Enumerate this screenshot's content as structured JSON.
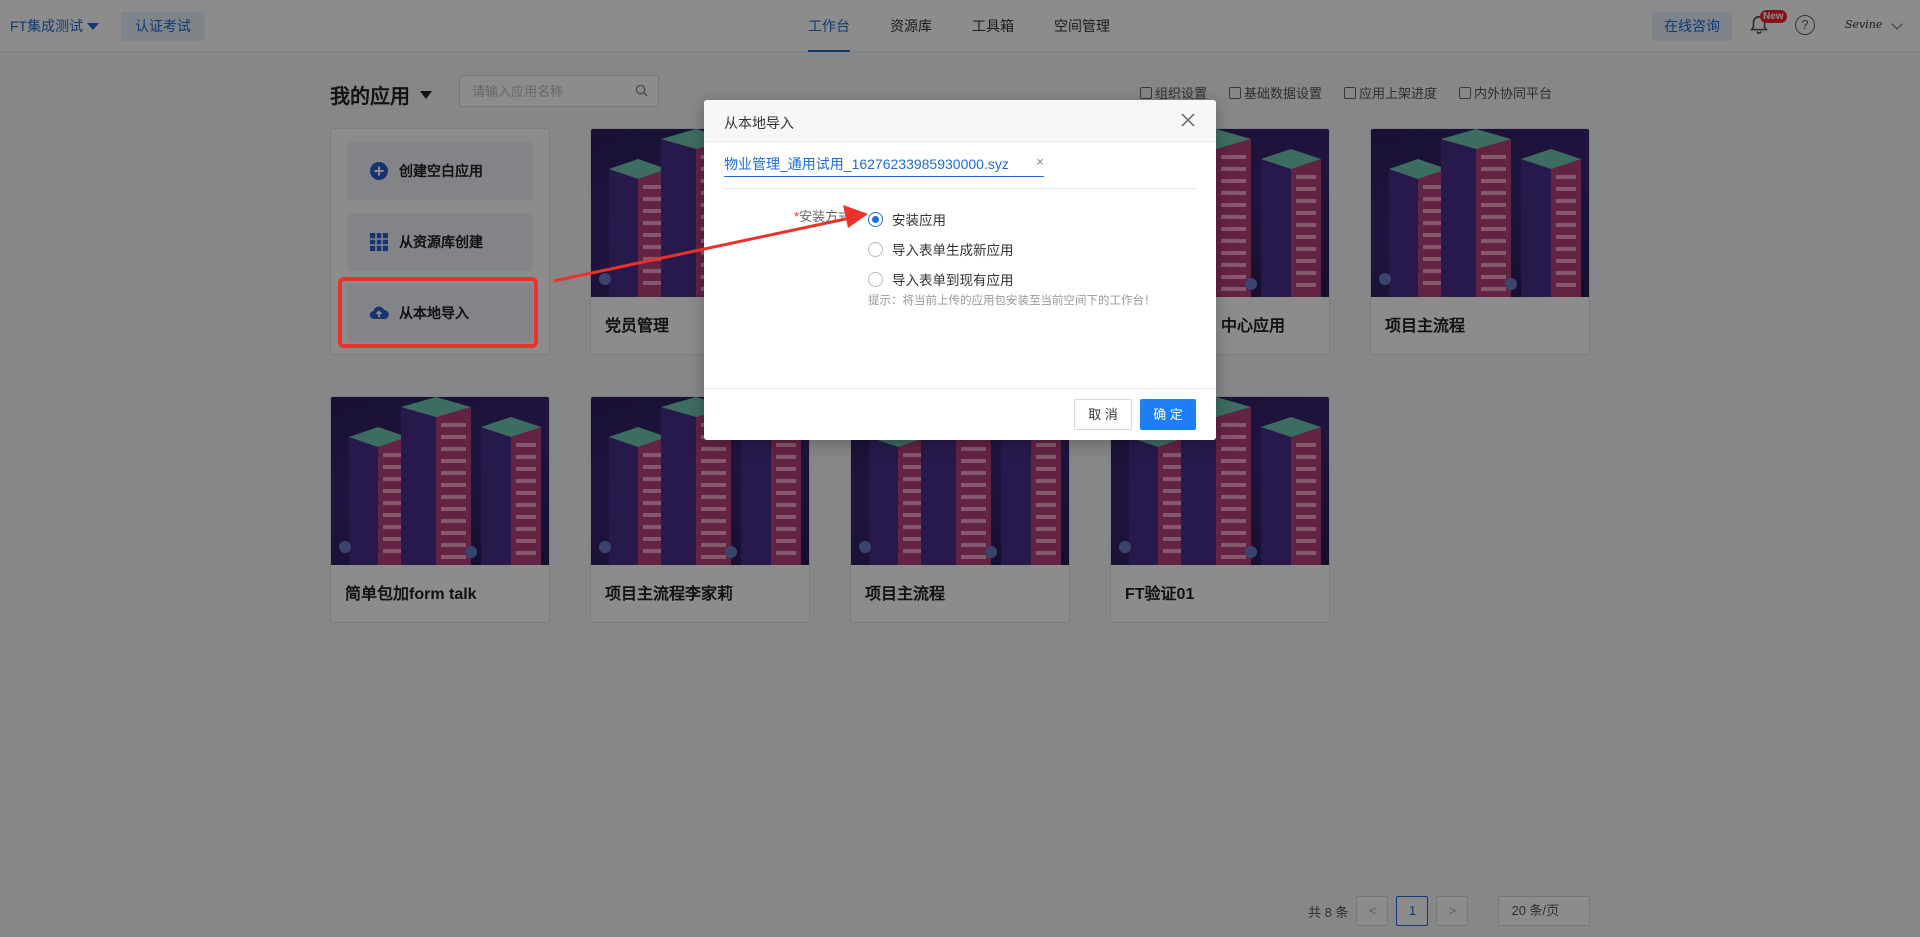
{
  "topbar": {
    "workspace": "FT集成测试",
    "exam_button": "认证考试",
    "nav": [
      "工作台",
      "资源库",
      "工具箱",
      "空间管理"
    ],
    "active_nav": "工作台",
    "consult_button": "在线咨询",
    "new_badge": "New",
    "help_symbol": "?",
    "username": "Sevine"
  },
  "header": {
    "title": "我的应用",
    "search_placeholder": "请输入应用名称",
    "links": [
      "组织设置",
      "基础数据设置",
      "应用上架进度",
      "内外协同平台"
    ]
  },
  "create_panel": {
    "items": [
      {
        "label": "创建空白应用",
        "icon": "plus-circle-icon"
      },
      {
        "label": "从资源库创建",
        "icon": "grid-icon"
      },
      {
        "label": "从本地导入",
        "icon": "cloud-upload-icon"
      }
    ]
  },
  "apps": [
    {
      "name": "党员管理"
    },
    {
      "name": "中心应用"
    },
    {
      "name": "项目主流程"
    },
    {
      "name": "简单包加form talk"
    },
    {
      "name": "项目主流程李家莉"
    },
    {
      "name": "项目主流程"
    },
    {
      "name": "FT验证01"
    }
  ],
  "modal": {
    "title": "从本地导入",
    "file_name": "物业管理_通用试用_16276233985930000.syz",
    "file_remove": "×",
    "install_label": "安装方式",
    "required_mark": "*",
    "options": [
      "安装应用",
      "导入表单生成新应用",
      "导入表单到现有应用"
    ],
    "selected_option": 0,
    "hint": "提示：将当前上传的应用包安装至当前空间下的工作台！",
    "cancel": "取 消",
    "confirm": "确 定"
  },
  "pagination": {
    "total": "共 8 条",
    "prev": "<",
    "current_page": "1",
    "next": ">",
    "page_size": "20 条/页"
  },
  "colors": {
    "primary": "#1e6bd6",
    "button_primary": "#1e7ef7",
    "annotation_red": "#e8322a"
  }
}
